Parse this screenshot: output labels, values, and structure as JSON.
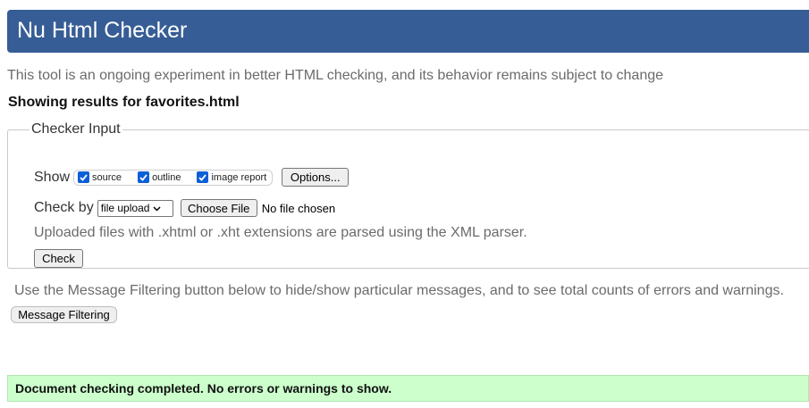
{
  "header": {
    "title": "Nu Html Checker"
  },
  "tagline": "This tool is an ongoing experiment in better HTML checking, and its behavior remains subject to change",
  "results_title": "Showing results for favorites.html",
  "checker_input": {
    "legend": "Checker Input",
    "show_label": "Show",
    "show_options": [
      {
        "label": "source",
        "checked": true
      },
      {
        "label": "outline",
        "checked": true
      },
      {
        "label": "image report",
        "checked": true
      }
    ],
    "options_button": "Options...",
    "check_by_label": "Check by",
    "check_by_selected": "file upload",
    "choose_file_button": "Choose File",
    "file_status": "No file chosen",
    "xml_note": "Uploaded files with .xhtml or .xht extensions are parsed using the XML parser.",
    "check_button": "Check"
  },
  "filter_note": "Use the Message Filtering button below to hide/show particular messages, and to see total counts of errors and warnings.",
  "filter_button": "Message Filtering",
  "result_message": "Document checking completed. No errors or warnings to show.",
  "colors": {
    "header_bg": "#365d95",
    "success_bg": "#ccffcc",
    "checkbox_accent": "#0b5fd7"
  }
}
